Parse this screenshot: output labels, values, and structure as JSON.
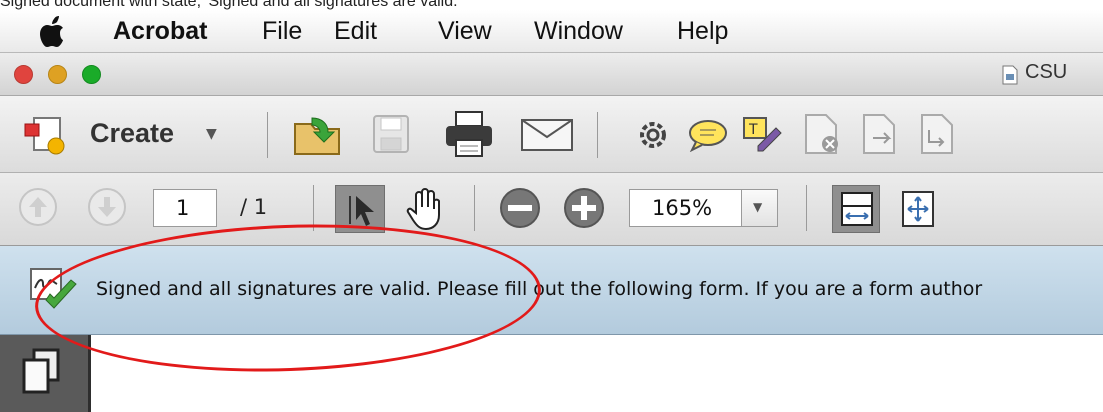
{
  "caption": "Signed document with state, 'Signed and all signatures are valid.'",
  "menubar": {
    "app_name": "Acrobat",
    "items": [
      "File",
      "Edit",
      "View",
      "Window",
      "Help"
    ]
  },
  "window": {
    "document_title": "CSU",
    "traffic_lights": [
      "#e0443e",
      "#dea123",
      "#1aab29"
    ]
  },
  "toolbar_primary": {
    "create_label": "Create",
    "icons": [
      "open-icon",
      "save-icon",
      "print-icon",
      "email-icon",
      "settings-icon",
      "comment-icon",
      "sign-icon",
      "page-icon-1",
      "page-icon-2",
      "page-icon-3"
    ]
  },
  "toolbar_nav": {
    "page_number": "1",
    "page_total": "/ 1",
    "zoom_value": "165%"
  },
  "signature_bar": {
    "message": "Signed and all signatures are valid.  Please fill out the following form. If you are a form author"
  },
  "annotation": {
    "color": "#e21a1a"
  }
}
